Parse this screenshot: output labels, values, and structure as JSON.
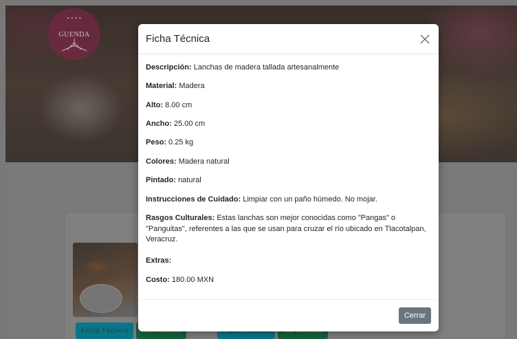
{
  "brand": {
    "logo_text": "GUENDA"
  },
  "background": {
    "buttons": [
      {
        "label": "Ficha Técnica"
      },
      {
        "label": "Me interesa"
      },
      {
        "label": "Ficha Técnica"
      },
      {
        "label": "Me interesa"
      }
    ]
  },
  "modal": {
    "title": "Ficha Técnica",
    "close_label": "×",
    "fields": [
      {
        "label": "Descripción:",
        "value": "Lanchas de madera tallada artesanalmente"
      },
      {
        "label": "Material:",
        "value": "Madera"
      },
      {
        "label": "Alto:",
        "value": "8.00 cm"
      },
      {
        "label": "Ancho:",
        "value": "25.00 cm"
      },
      {
        "label": "Peso:",
        "value": "0.25 kg"
      },
      {
        "label": "Colores:",
        "value": "Madera natural"
      },
      {
        "label": "Pintado:",
        "value": "natural"
      },
      {
        "label": "Instrucciones de Cuidado:",
        "value": "Limpiar con un paño húmedo. No mojar."
      },
      {
        "label": "Rasgos Culturales:",
        "value": "Estas lanchas son mejor conocidas como \"Pangas\" o \"Panguitas\", referentes a las que se usan para cruzar el río ubicado en Tlacotalpan, Veracruz."
      },
      {
        "label": "Extras:",
        "value": ""
      },
      {
        "label": "Costo:",
        "value": "180.00 MXN"
      }
    ],
    "footer": {
      "close_button": "Cerrar"
    }
  },
  "colors": {
    "close_button_bg": "#6c757d",
    "info_button": "#17a2b8",
    "success_button": "#28a745"
  }
}
